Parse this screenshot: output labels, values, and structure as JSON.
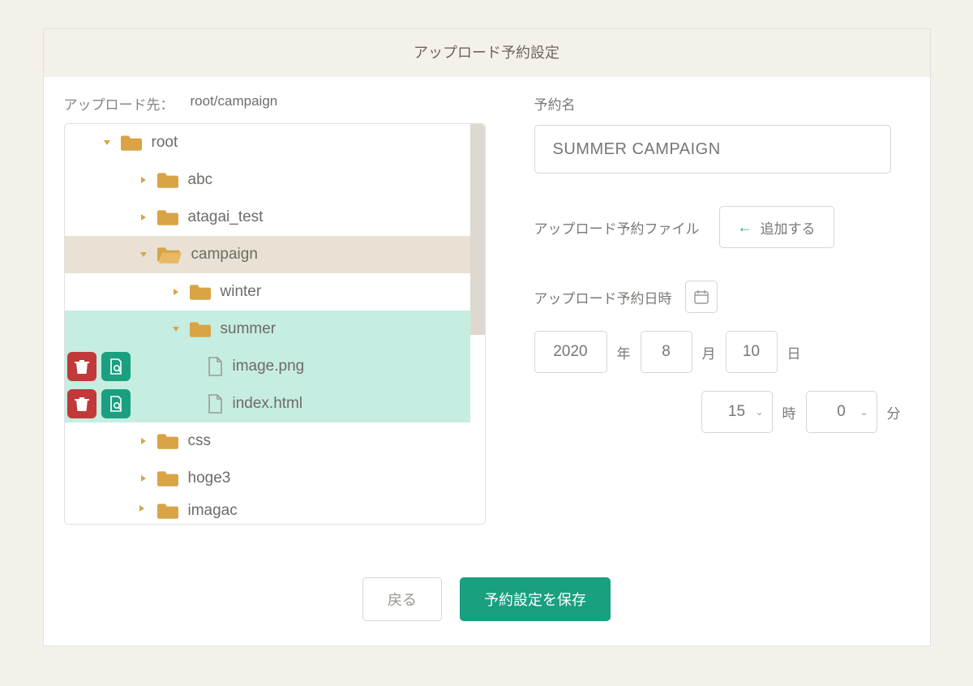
{
  "header": {
    "title": "アップロード予約設定"
  },
  "left": {
    "dest_label": "アップロード先：",
    "dest_path": "root/campaign",
    "tree": {
      "root": "root",
      "abc": "abc",
      "atagai_test": "atagai_test",
      "campaign": "campaign",
      "winter": "winter",
      "summer": "summer",
      "image_png": "image.png",
      "index_html": "index.html",
      "css": "css",
      "hoge3": "hoge3",
      "images": "imagac"
    }
  },
  "right": {
    "reservation_name_label": "予約名",
    "reservation_name_value": "SUMMER CAMPAIGN",
    "upload_file_label": "アップロード予約ファイル",
    "add_button": "追加する",
    "datetime_label": "アップロード予約日時",
    "year": "2020",
    "year_unit": "年",
    "month": "8",
    "month_unit": "月",
    "day": "10",
    "day_unit": "日",
    "hour": "15",
    "hour_unit": "時",
    "minute": "0",
    "minute_unit": "分"
  },
  "footer": {
    "back": "戻る",
    "save": "予約設定を保存"
  }
}
